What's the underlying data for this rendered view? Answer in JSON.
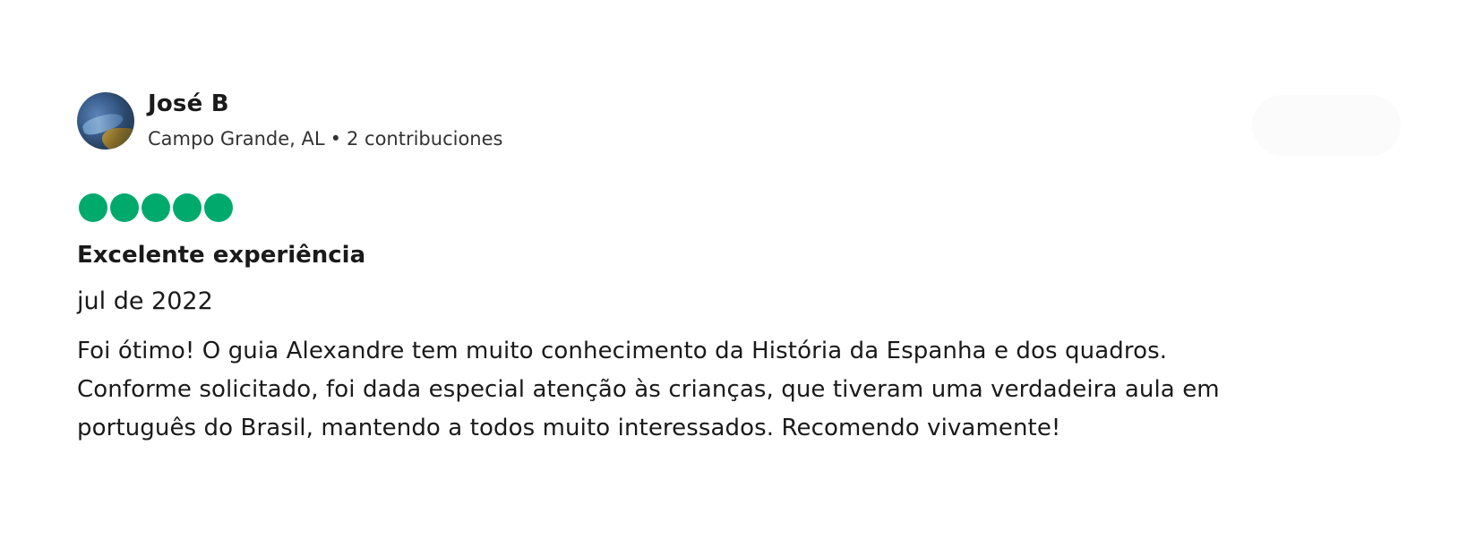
{
  "reviewer": {
    "name": "José B",
    "location": "Campo Grande, AL",
    "separator": "•",
    "contributions": "2 contribuciones"
  },
  "review": {
    "rating": 5,
    "rating_max": 5,
    "rating_color": "#00aa6c",
    "title": "Excelente experiência",
    "date": "jul de 2022",
    "body_lines": [
      "Foi ótimo! O guia Alexandre tem muito conhecimento da História da Espanha e dos quadros.",
      "Conforme solicitado, foi dada especial atenção às crianças, que tiveram uma verdadeira aula em",
      "português do Brasil, mantendo a todos muito interessados. Recomendo vivamente!"
    ]
  },
  "icons": {
    "avatar": "user-avatar-photo",
    "rating": "rating-bubble-icon"
  }
}
